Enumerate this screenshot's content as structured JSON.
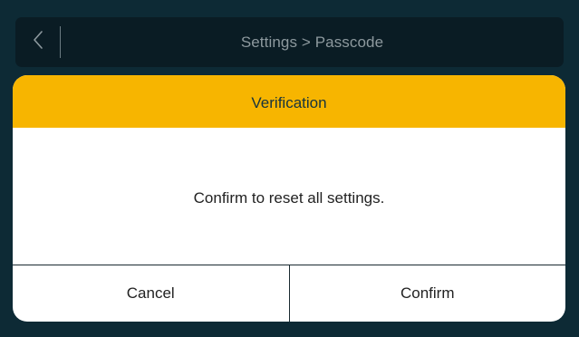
{
  "header": {
    "back_icon": "chevron-left-icon",
    "breadcrumb": "Settings > Passcode"
  },
  "dialog": {
    "title": "Verification",
    "message": "Confirm to reset all settings.",
    "cancel_label": "Cancel",
    "confirm_label": "Confirm"
  },
  "colors": {
    "background": "#0d2a35",
    "topbar": "#0a1c24",
    "dialog_header": "#f7b500",
    "dialog_body": "#ffffff"
  }
}
